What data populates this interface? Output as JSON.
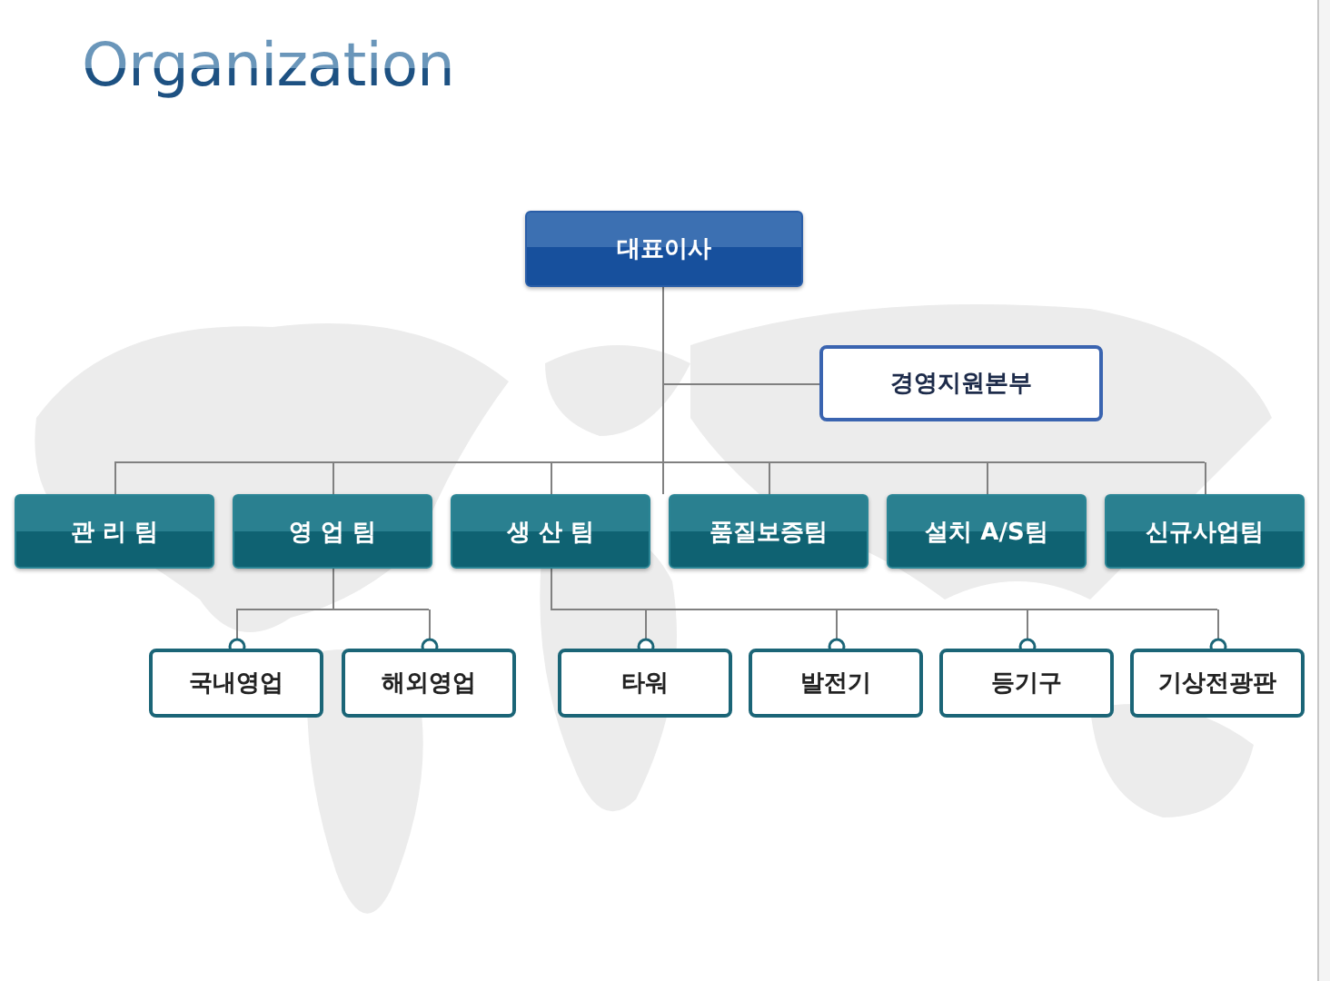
{
  "title": "Organization",
  "ceo": {
    "label": "대표이사"
  },
  "support": {
    "label": "경영지원본부"
  },
  "teams": [
    {
      "label": "관 리 팀"
    },
    {
      "label": "영 업 팀",
      "children": [
        {
          "label": "국내영업"
        },
        {
          "label": "해외영업"
        }
      ]
    },
    {
      "label": "생 산 팀",
      "children": [
        {
          "label": "타워"
        },
        {
          "label": "발전기"
        },
        {
          "label": "등기구"
        },
        {
          "label": "기상전광판"
        }
      ]
    },
    {
      "label": "품질보증팀"
    },
    {
      "label": "설치 A/S팀"
    },
    {
      "label": "신규사업팀"
    }
  ]
}
